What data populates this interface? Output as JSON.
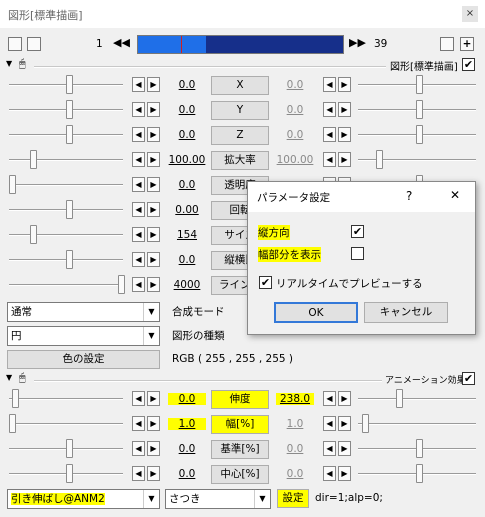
{
  "window": {
    "title": "図形[標準描画]",
    "close": "×"
  },
  "timeline": {
    "start": "1",
    "end": "39",
    "first_icon": "◀◀",
    "last_icon": "▶▶",
    "plus": "+",
    "progress": 0.33,
    "cursor": 0.21
  },
  "section1": {
    "label": "図形[標準描画]",
    "checked": "✔"
  },
  "arrows": {
    "left": "◀",
    "right": "▶",
    "dropdown": "▼",
    "expand": "▼"
  },
  "params": [
    {
      "label": "X",
      "left": "0.0",
      "right": "0.0"
    },
    {
      "label": "Y",
      "left": "0.0",
      "right": "0.0"
    },
    {
      "label": "Z",
      "left": "0.0",
      "right": "0.0"
    },
    {
      "label": "拡大率",
      "left": "100.00",
      "right": "100.00"
    },
    {
      "label": "透明度",
      "left": "0.0",
      "right": ""
    },
    {
      "label": "回転",
      "left": "0.00",
      "right": ""
    },
    {
      "label": "サイズ",
      "left": "154",
      "right": ""
    },
    {
      "label": "縦横比",
      "left": "0.0",
      "right": ""
    },
    {
      "label": "ライン幅",
      "left": "4000",
      "right": ""
    }
  ],
  "blend": {
    "value": "通常",
    "label": "合成モード"
  },
  "shape": {
    "value": "円",
    "label": "図形の種類"
  },
  "color": {
    "button": "色の設定",
    "rgb": "RGB ( 255 , 255 , 255 )"
  },
  "section2": {
    "label": "アニメーション効果",
    "checked": "✔"
  },
  "anim_params": [
    {
      "label": "伸度",
      "left": "0.0",
      "right": "238.0"
    },
    {
      "label": "幅[%]",
      "left": "1.0",
      "right": "1.0"
    },
    {
      "label": "基準[%]",
      "left": "0.0",
      "right": "0.0"
    },
    {
      "label": "中心[%]",
      "left": "0.0",
      "right": "0.0"
    }
  ],
  "effect": {
    "value": "引き伸ばし@ANM2",
    "sub": "さつき",
    "settings": "設定",
    "params": "dir=1;alp=0;"
  },
  "dialog": {
    "title": "パラメータ設定",
    "help": "?",
    "close": "✕",
    "vertical": "縦方向",
    "vertical_checked": "✔",
    "show_width": "幅部分を表示",
    "realtime": "リアルタイムでプレビューする",
    "realtime_checked": "✔",
    "ok": "OK",
    "cancel": "キャンセル"
  }
}
